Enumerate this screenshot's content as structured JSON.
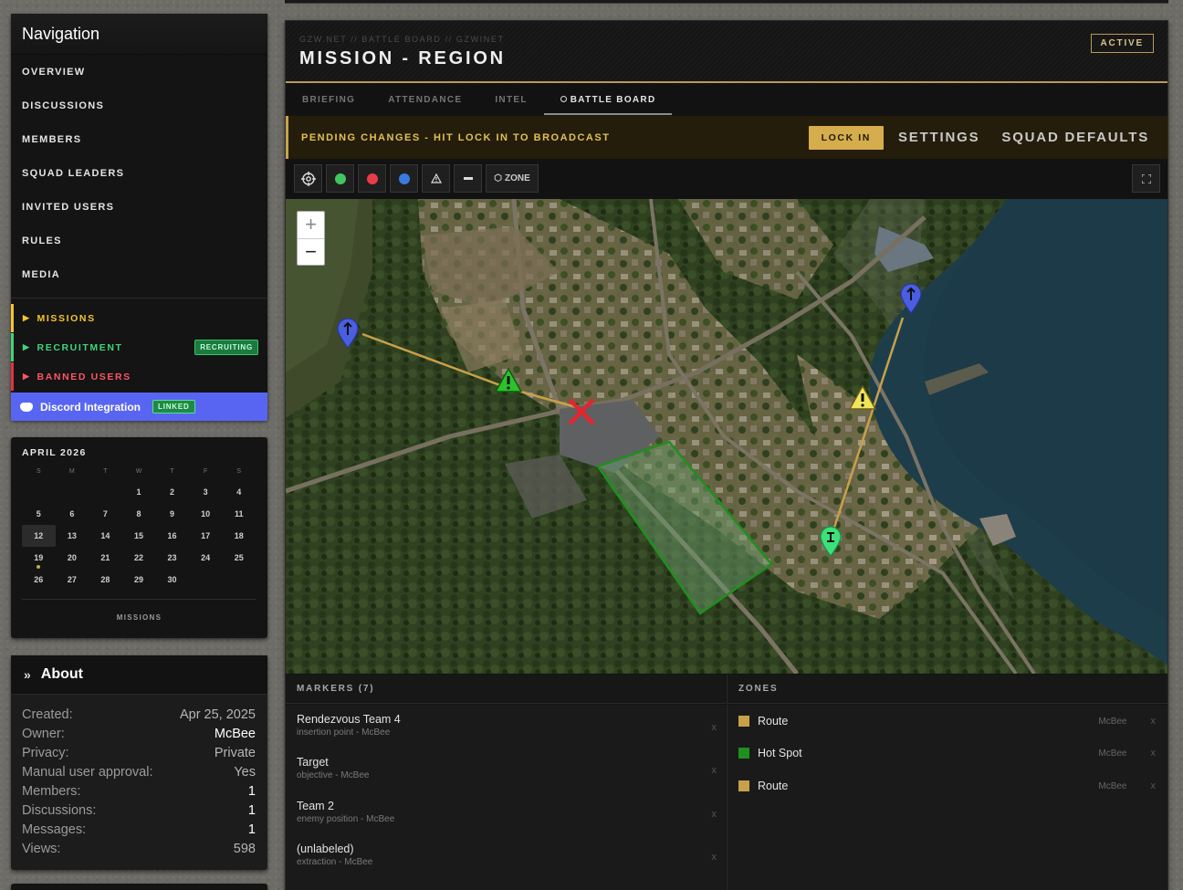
{
  "nav": {
    "title": "Navigation",
    "items": [
      "OVERVIEW",
      "DISCUSSIONS",
      "MEMBERS",
      "SQUAD LEADERS",
      "INVITED USERS",
      "RULES",
      "MEDIA"
    ],
    "missions": "MISSIONS",
    "recruitment": "RECRUITMENT",
    "recruiting_badge": "RECRUITING",
    "banned": "BANNED USERS",
    "discord": "Discord Integration",
    "linked_badge": "LINKED"
  },
  "calendar": {
    "title": "APRIL 2026",
    "dow": [
      "S",
      "M",
      "T",
      "W",
      "T",
      "F",
      "S"
    ],
    "days": [
      "",
      "",
      "",
      "1",
      "2",
      "3",
      "4",
      "5",
      "6",
      "7",
      "8",
      "9",
      "10",
      "11",
      "12",
      "13",
      "14",
      "15",
      "16",
      "17",
      "18",
      "19",
      "20",
      "21",
      "22",
      "23",
      "24",
      "25",
      "26",
      "27",
      "28",
      "29",
      "30",
      "",
      ""
    ],
    "today": "12",
    "event_day": "19",
    "footer": "MISSIONS"
  },
  "about": {
    "title": "About",
    "rows": [
      {
        "label": "Created:",
        "value": "Apr 25, 2025"
      },
      {
        "label": "Owner:",
        "value": "McBee"
      },
      {
        "label": "Privacy:",
        "value": "Private"
      },
      {
        "label": "Manual user approval:",
        "value": "Yes"
      },
      {
        "label": "Members:",
        "value": "1"
      },
      {
        "label": "Discussions:",
        "value": "1"
      },
      {
        "label": "Messages:",
        "value": "1"
      },
      {
        "label": "Views:",
        "value": "598"
      }
    ]
  },
  "mission": {
    "breadcrumb": "GZW.NET // BATTLE BOARD // GZWINET",
    "title": "MISSION - REGION",
    "status": "ACTIVE",
    "tabs": [
      "BRIEFING",
      "ATTENDANCE",
      "INTEL",
      "BATTLE BOARD"
    ],
    "selected_tab": "BATTLE BOARD",
    "pending": "PENDING CHANGES - HIT LOCK IN TO BROADCAST",
    "lock_in": "LOCK IN",
    "settings": "SETTINGS",
    "squad_defaults": "SQUAD DEFAULTS"
  },
  "toolbar": {
    "zone_label": "ZONE",
    "colors": {
      "green": "#43c462",
      "red": "#e93c49",
      "blue": "#3a7ae0"
    }
  },
  "map": {
    "zoom_in": "+",
    "zoom_out": "−"
  },
  "markers": {
    "header": "MARKERS (7)",
    "items": [
      {
        "name": "Rendezvous Team 4",
        "sub": "insertion point - McBee"
      },
      {
        "name": "Target",
        "sub": "objective - McBee"
      },
      {
        "name": "Team 2",
        "sub": "enemy position - McBee"
      },
      {
        "name": "(unlabeled)",
        "sub": "extraction - McBee"
      }
    ]
  },
  "zones": {
    "header": "ZONES",
    "items": [
      {
        "name": "Route",
        "owner": "McBee",
        "color": "#c9a04a"
      },
      {
        "name": "Hot Spot",
        "owner": "McBee",
        "color": "#1f8f1f"
      },
      {
        "name": "Route",
        "owner": "McBee",
        "color": "#c9a04a"
      }
    ]
  },
  "remove_symbol": "x"
}
